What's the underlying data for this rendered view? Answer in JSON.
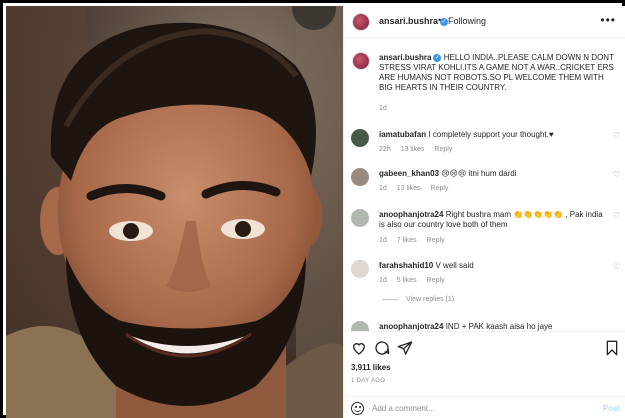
{
  "header": {
    "username": "ansari.bushra",
    "separator": "•",
    "follow_status": "Following",
    "more_icon": "more-horizontal-icon"
  },
  "caption": {
    "username": "ansari.bushra",
    "text": "HELLO INDIA..PLEASE CALM DOWN N DONT STRESS VIRAT KOHLI.ITS A GAME NOT A WAR..CRICKET ERS ARE HUMANS NOT ROBOTS.SO PL WELCOME THEM WITH BIG HEARTS IN THEIR COUNTRY.",
    "time": "1d"
  },
  "comments": [
    {
      "username": "iamatubafan",
      "text": "I completely support your thought.♥",
      "time": "22h",
      "likes": "13 likes",
      "reply": "Reply"
    },
    {
      "username": "gabeen_khan03",
      "text": "😢😢😢 itni hum dardi",
      "time": "1d",
      "likes": "13 likes",
      "reply": "Reply"
    },
    {
      "username": "anoophanjotra24",
      "text": "Right bushra mam 👏👏👏👏👏 , Pak india is also our country love both of them",
      "time": "1d",
      "likes": "7 likes",
      "reply": "Reply"
    },
    {
      "username": "farahshahid10",
      "text": "V well said",
      "time": "1d",
      "likes": "5 likes",
      "reply": "Reply",
      "view_replies": "View replies (1)"
    },
    {
      "username": "anoophanjotra24",
      "text": "IND + PAK kaash aisa ho jaye",
      "time": "",
      "likes": "",
      "reply": ""
    }
  ],
  "actions": {
    "like_icon": "heart-icon",
    "comment_icon": "comment-icon",
    "share_icon": "share-icon",
    "save_icon": "bookmark-icon"
  },
  "likes_count": "3,911 likes",
  "posted_ago": "1 DAY AGO",
  "add_comment": {
    "placeholder": "Add a comment...",
    "post_label": "Post",
    "emoji_icon": "emoji-icon"
  },
  "colors": {
    "link_blue": "#3897f0",
    "post_disabled": "#b2dffc",
    "muted": "#8e8e8e"
  }
}
